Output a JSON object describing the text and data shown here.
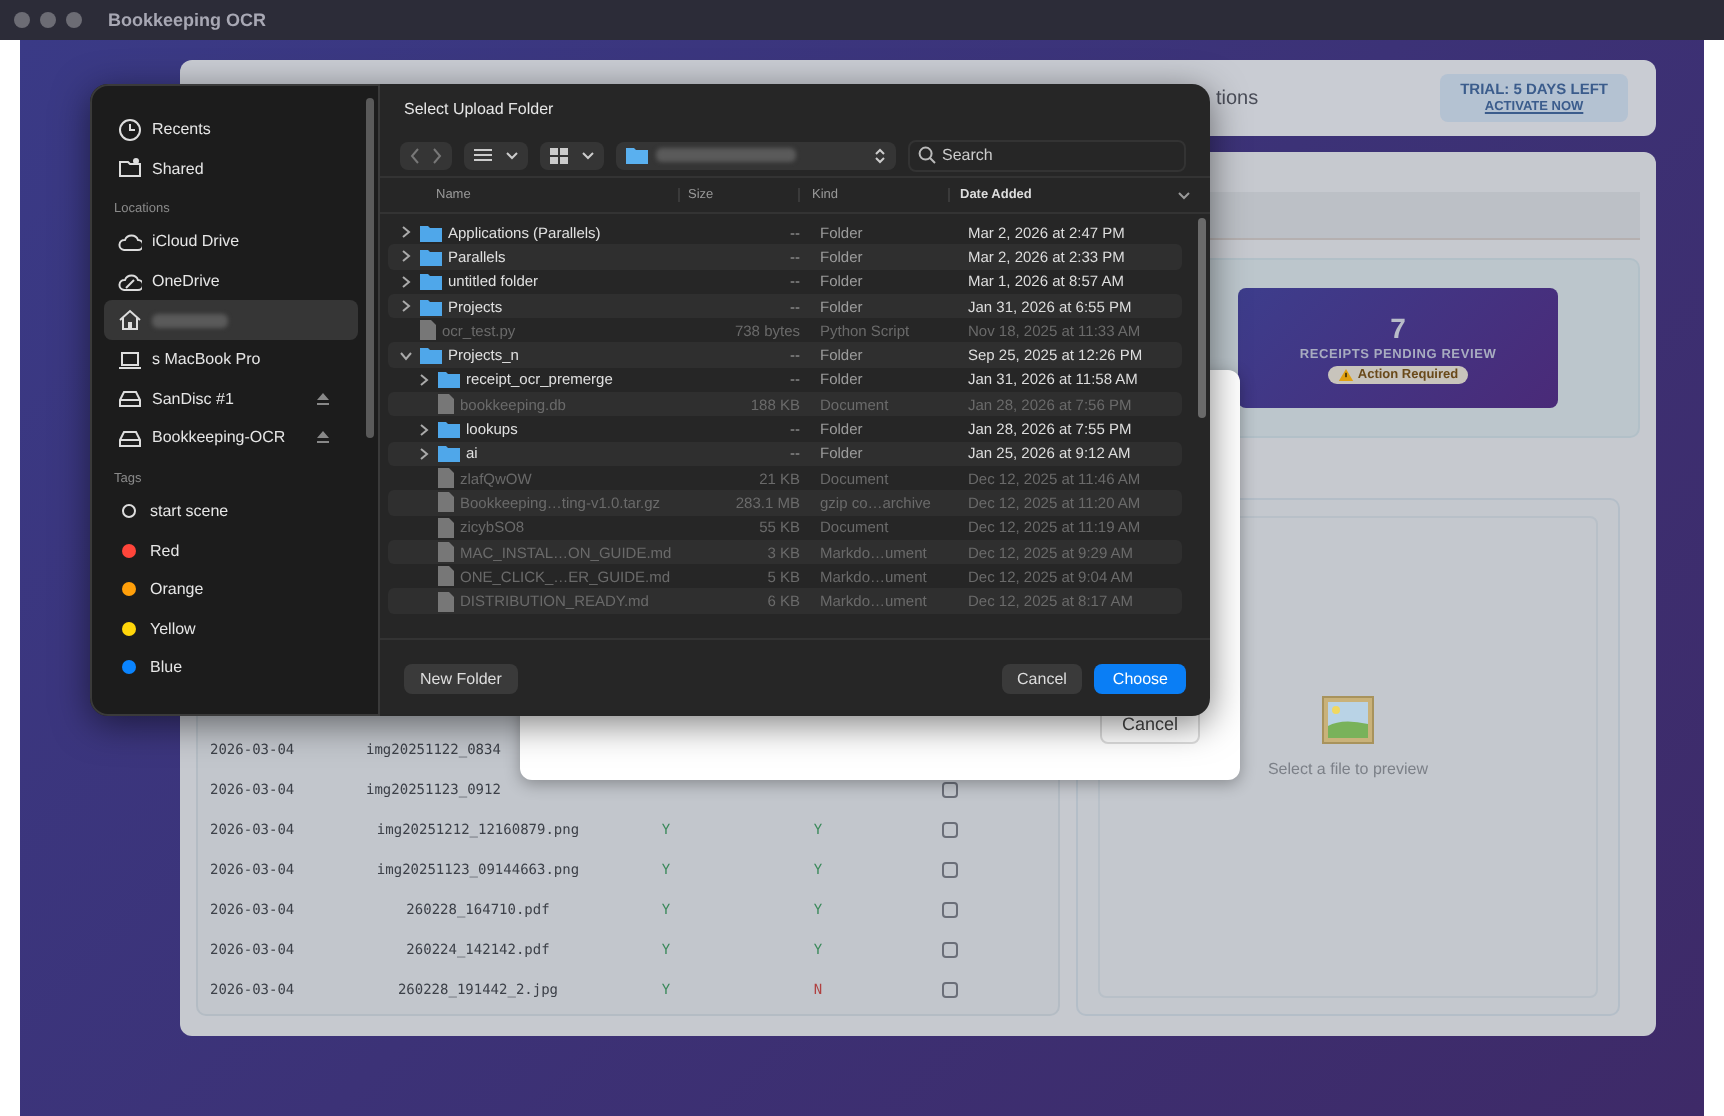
{
  "window": {
    "title": "Bookkeeping OCR"
  },
  "header": {
    "title_fragment": "tions",
    "trial": {
      "label": "TRIAL: 5 DAYS LEFT",
      "link": "ACTIVATE NOW"
    }
  },
  "pending_card": {
    "count": "7",
    "label": "RECEIPTS PENDING REVIEW",
    "badge": "Action Required"
  },
  "receipts_table": {
    "rows": [
      {
        "date": "2026-03-04",
        "file": "img20251122_0834"
      },
      {
        "date": "2026-03-04",
        "file": "img20251123_0912",
        "checked": false
      },
      {
        "date": "2026-03-04",
        "file": "img20251212_12160879.png",
        "column_3": {
          "text": "Y",
          "positive": true
        },
        "column_4": {
          "text": "Y",
          "positive": true
        },
        "checked": false
      },
      {
        "date": "2026-03-04",
        "file": "img20251123_09144663.png",
        "column_3": {
          "text": "Y",
          "positive": true
        },
        "column_4": {
          "text": "Y",
          "positive": true
        },
        "checked": false
      },
      {
        "date": "2026-03-04",
        "file": "260228_164710.pdf",
        "column_3": {
          "text": "Y",
          "positive": true
        },
        "column_4": {
          "text": "Y",
          "positive": true
        },
        "checked": false
      },
      {
        "date": "2026-03-04",
        "file": "260224_142142.pdf",
        "column_3": {
          "text": "Y",
          "positive": true
        },
        "column_4": {
          "text": "Y",
          "positive": true
        },
        "checked": false
      },
      {
        "date": "2026-03-04",
        "file": "260228_191442_2.jpg",
        "column_3": {
          "text": "Y",
          "positive": true
        },
        "column_4": {
          "text": "N",
          "positive": false
        },
        "checked": false
      }
    ]
  },
  "preview": {
    "message": "Select a file to preview"
  },
  "back_dialog": {
    "buttons": [
      "Cancel"
    ]
  },
  "file_dialog": {
    "title": "Select Upload Folder",
    "sidebar": {
      "sections": [
        {
          "items": [
            {
              "label": "Recents",
              "kind": "clock",
              "selected": false
            },
            {
              "label": "Shared",
              "kind": "shared",
              "selected": false
            }
          ]
        },
        {
          "heading": "Locations",
          "items": [
            {
              "label": "iCloud Drive",
              "kind": "cloud",
              "selected": false
            },
            {
              "label": "OneDrive",
              "kind": "onedrive",
              "selected": false
            },
            {
              "kind": "home",
              "selected": true
            },
            {
              "label": "s MacBook Pro",
              "kind": "laptop",
              "selected": false
            },
            {
              "label": "SanDisc #1",
              "kind": "drive",
              "ejectable": true,
              "selected": false
            },
            {
              "label": "Bookkeeping-OCR",
              "kind": "drive",
              "ejectable": true,
              "selected": false
            }
          ]
        },
        {
          "heading": "Tags",
          "items": [
            {
              "label": "start scene",
              "kind": "tag",
              "selected": false
            },
            {
              "label": "Red",
              "kind": "tag",
              "color": "#ff453a",
              "selected": false
            },
            {
              "label": "Orange",
              "kind": "tag",
              "color": "#ff9f0a",
              "selected": false
            },
            {
              "label": "Yellow",
              "kind": "tag",
              "color": "#ffd60a",
              "selected": false
            },
            {
              "label": "Blue",
              "kind": "tag",
              "color": "#0a84ff",
              "selected": false
            }
          ]
        }
      ]
    },
    "search": {
      "placeholder": "Search"
    },
    "columns": [
      {
        "label": "Name",
        "sorted": false
      },
      {
        "label": "Size",
        "sorted": false
      },
      {
        "label": "Kind",
        "sorted": false
      },
      {
        "label": "Date Added",
        "sorted": true
      }
    ],
    "entries": [
      {
        "kind": "folder",
        "name": "Applications (Parallels)",
        "size": "--",
        "type": "Folder",
        "date_added": "Mar 2, 2026 at 2:47 PM",
        "expanded": false
      },
      {
        "kind": "folder",
        "name": "Parallels",
        "size": "--",
        "type": "Folder",
        "date_added": "Mar 2, 2026 at 2:33 PM",
        "expanded": false
      },
      {
        "kind": "folder",
        "name": "untitled folder",
        "size": "--",
        "type": "Folder",
        "date_added": "Mar 1, 2026 at 8:57 AM",
        "expanded": false
      },
      {
        "kind": "folder",
        "name": "Projects",
        "size": "--",
        "type": "Folder",
        "date_added": "Jan 31, 2026 at 6:55 PM",
        "expanded": false
      },
      {
        "kind": "file",
        "name": "ocr_test.py",
        "size": "738 bytes",
        "type": "Python Script",
        "date_added": "Nov 18, 2025 at 11:33 AM"
      },
      {
        "kind": "folder",
        "name": "Projects_n",
        "size": "--",
        "type": "Folder",
        "date_added": "Sep 25, 2025 at 12:26 PM",
        "expanded": true,
        "children": [
          {
            "kind": "folder",
            "name": "receipt_ocr_premerge",
            "size": "--",
            "type": "Folder",
            "date_added": "Jan 31, 2026 at 11:58 AM",
            "expanded": false
          },
          {
            "kind": "file",
            "name": "bookkeeping.db",
            "size": "188 KB",
            "type": "Document",
            "date_added": "Jan 28, 2026 at 7:56 PM"
          },
          {
            "kind": "folder",
            "name": "lookups",
            "size": "--",
            "type": "Folder",
            "date_added": "Jan 28, 2026 at 7:55 PM",
            "expanded": false
          },
          {
            "kind": "folder",
            "name": "ai",
            "size": "--",
            "type": "Folder",
            "date_added": "Jan 25, 2026 at 9:12 AM",
            "expanded": false
          },
          {
            "kind": "file",
            "name": "zlafQwOW",
            "size": "21 KB",
            "type": "Document",
            "date_added": "Dec 12, 2025 at 11:46 AM"
          },
          {
            "kind": "file",
            "name": "Bookkeeping…ting-v1.0.tar.gz",
            "size": "283.1 MB",
            "type": "gzip co…archive",
            "date_added": "Dec 12, 2025 at 11:20 AM"
          },
          {
            "kind": "file",
            "name": "zicybSO8",
            "size": "55 KB",
            "type": "Document",
            "date_added": "Dec 12, 2025 at 11:19 AM"
          },
          {
            "kind": "file",
            "name": "MAC_INSTAL…ON_GUIDE.md",
            "size": "3 KB",
            "type": "Markdo…ument",
            "date_added": "Dec 12, 2025 at 9:29 AM"
          },
          {
            "kind": "file",
            "name": "ONE_CLICK_…ER_GUIDE.md",
            "size": "5 KB",
            "type": "Markdo…ument",
            "date_added": "Dec 12, 2025 at 9:04 AM"
          },
          {
            "kind": "file",
            "name": "DISTRIBUTION_READY.md",
            "size": "6 KB",
            "type": "Markdo…ument",
            "date_added": "Dec 12, 2025 at 8:17 AM"
          }
        ]
      }
    ],
    "footer": {
      "new_folder": "New Folder",
      "cancel": "Cancel",
      "choose": "Choose"
    }
  }
}
